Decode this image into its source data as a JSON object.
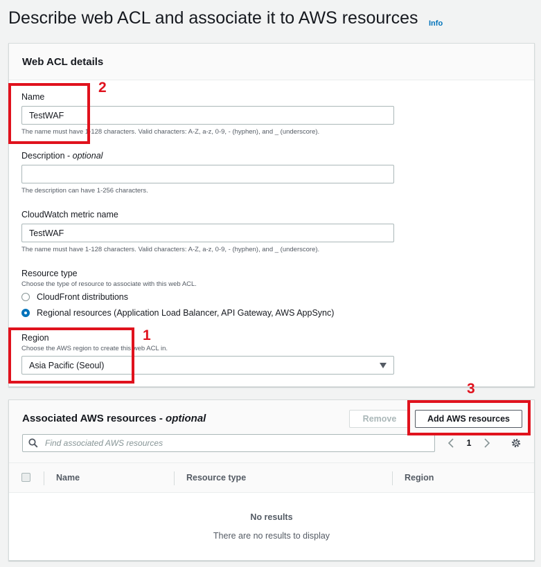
{
  "page": {
    "title": "Describe web ACL and associate it to AWS resources",
    "info_link": "Info"
  },
  "details": {
    "title": "Web ACL details",
    "name": {
      "label": "Name",
      "value": "TestWAF",
      "hint": "The name must have 1-128 characters. Valid characters: A-Z, a-z, 0-9, - (hyphen), and _ (underscore)."
    },
    "description": {
      "label": "Description - ",
      "label_optional": "optional",
      "value": "",
      "hint": "The description can have 1-256 characters."
    },
    "metric": {
      "label": "CloudWatch metric name",
      "value": "TestWAF",
      "hint": "The name must have 1-128 characters. Valid characters: A-Z, a-z, 0-9, - (hyphen), and _ (underscore)."
    },
    "resource_type": {
      "label": "Resource type",
      "hint": "Choose the type of resource to associate with this web ACL.",
      "options": [
        {
          "label": "CloudFront distributions",
          "selected": false
        },
        {
          "label": "Regional resources (Application Load Balancer, API Gateway, AWS AppSync)",
          "selected": true
        }
      ]
    },
    "region": {
      "label": "Region",
      "hint": "Choose the AWS region to create this web ACL in.",
      "selected": "Asia Pacific (Seoul)"
    }
  },
  "associated": {
    "title": "Associated AWS resources - ",
    "title_optional": "optional",
    "remove_label": "Remove",
    "add_label": "Add AWS resources",
    "search_placeholder": "Find associated AWS resources",
    "page_number": "1",
    "columns": [
      "Name",
      "Resource type",
      "Region"
    ],
    "empty_title": "No results",
    "empty_text": "There are no results to display"
  },
  "annotations": {
    "marker_1": "1",
    "marker_2": "2",
    "marker_3": "3",
    "color": "#e0121d"
  },
  "colors": {
    "accent": "#0073bb",
    "text": "#16191f",
    "muted": "#545b64",
    "background": "#f2f3f3"
  },
  "icons": [
    "search-icon",
    "chevron-left-icon",
    "chevron-right-icon",
    "gear-icon",
    "caret-down-icon"
  ]
}
